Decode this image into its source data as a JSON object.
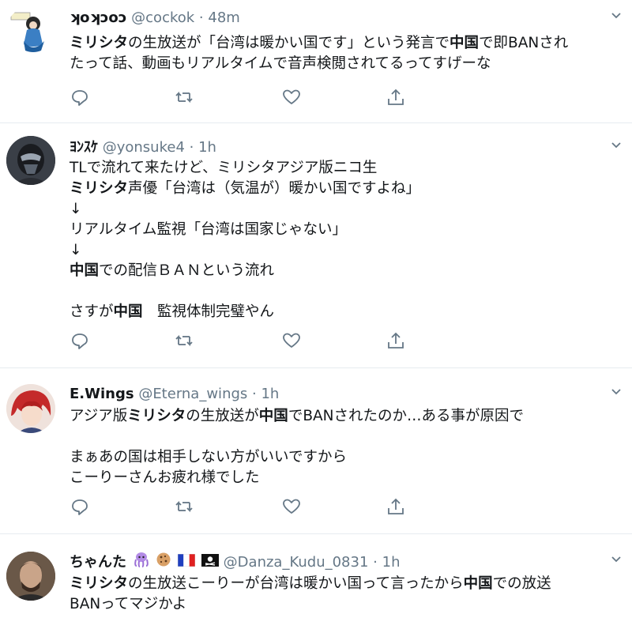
{
  "tweets": [
    {
      "display_name": "ʞoʞɔoɔ",
      "handle": "@cockok",
      "sep": "·",
      "time": "48m",
      "lines": [
        [
          {
            "t": "ミリシタ",
            "b": true
          },
          {
            "t": "の生放送が「台湾は暖かい国です」という発言で"
          },
          {
            "t": "中国",
            "b": true
          },
          {
            "t": "で即BANされ"
          }
        ],
        [
          {
            "t": "たって話、動画もリアルタイムで音声検閲されてるってすげーな"
          }
        ]
      ]
    },
    {
      "display_name": "ﾖﾝｽｹ",
      "handle": "@yonsuke4",
      "sep": "·",
      "time": "1h",
      "lines": [
        [
          {
            "t": "TLで流れて来たけど、ミリシタアジア版ニコ生"
          }
        ],
        [
          {
            "t": "ミリシタ",
            "b": true
          },
          {
            "t": "声優「台湾は（気温が）暖かい国ですよね」"
          }
        ],
        [
          {
            "t": "↓"
          }
        ],
        [
          {
            "t": "リアルタイム監視「台湾は国家じゃない」"
          }
        ],
        [
          {
            "t": "↓"
          }
        ],
        [
          {
            "t": "中国",
            "b": true
          },
          {
            "t": "での配信ＢＡＮという流れ"
          }
        ],
        [
          {
            "t": ""
          }
        ],
        [
          {
            "t": "さすが"
          },
          {
            "t": "中国",
            "b": true
          },
          {
            "t": "　監視体制完璧やん"
          }
        ]
      ]
    },
    {
      "display_name": "E.Wings",
      "handle": "@Eterna_wings",
      "sep": "·",
      "time": "1h",
      "lines": [
        [
          {
            "t": "アジア版"
          },
          {
            "t": "ミリシタ",
            "b": true
          },
          {
            "t": "の生放送が"
          },
          {
            "t": "中国",
            "b": true
          },
          {
            "t": "でBANされたのか…ある事が原因で"
          }
        ],
        [
          {
            "t": ""
          }
        ],
        [
          {
            "t": "まぁあの国は相手しない方がいいですから"
          }
        ],
        [
          {
            "t": "こーりーさんお疲れ様でした"
          }
        ]
      ]
    },
    {
      "display_name": "ちゃんた",
      "handle": "@Danza_Kudu_0831",
      "sep": "·",
      "time": "1h",
      "lines": [
        [
          {
            "t": "ミリシタ",
            "b": true
          },
          {
            "t": "の生放送こーりーが台湾は暖かい国って言ったから"
          },
          {
            "t": "中国",
            "b": true
          },
          {
            "t": "での放送"
          }
        ],
        [
          {
            "t": "BANってマジかよ"
          }
        ]
      ]
    }
  ],
  "actions": [
    "reply",
    "retweet",
    "like",
    "share"
  ],
  "colors": {
    "icon": "#657786",
    "divider": "#e6ecf0",
    "text": "#14171a",
    "meta": "#657786"
  }
}
